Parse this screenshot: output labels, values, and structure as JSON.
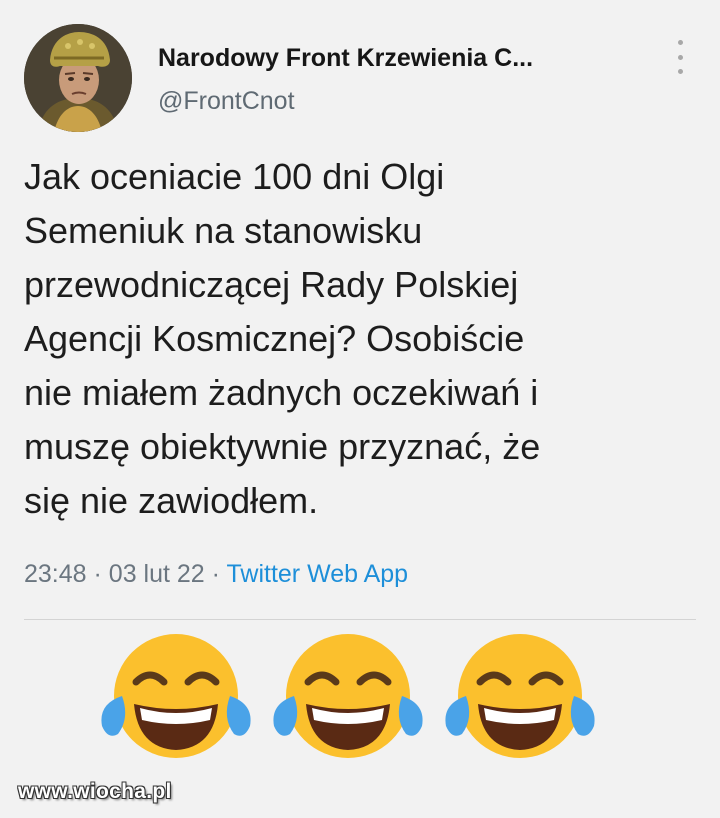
{
  "tweet": {
    "author_name": "Narodowy Front Krzewienia C...",
    "author_handle": "@FrontCnot",
    "text": "Jak oceniacie 100 dni Olgi\nSemeniuk na stanowisku\nprzewodniczącej Rady Polskiej\nAgencji Kosmicznej? Osobiście\nnie miałem żadnych oczekiwań i\nmuszę obiektywnie przyznać, że\nsię nie zawiodłem.",
    "time": "23:48",
    "date": "03 lut 22",
    "separator": "·",
    "source_app": "Twitter Web App",
    "more_icon": "vertical-dots-icon"
  },
  "reactions": {
    "emoji_name": "face-with-tears-of-joy-icon",
    "count": 3
  },
  "watermark": "www.wiocha.pl",
  "colors": {
    "background": "#f2f2f2",
    "link": "#1d8fd9",
    "muted": "#6b7680",
    "emoji_yellow": "#fbc02d",
    "tear_blue": "#4aa3e8"
  }
}
